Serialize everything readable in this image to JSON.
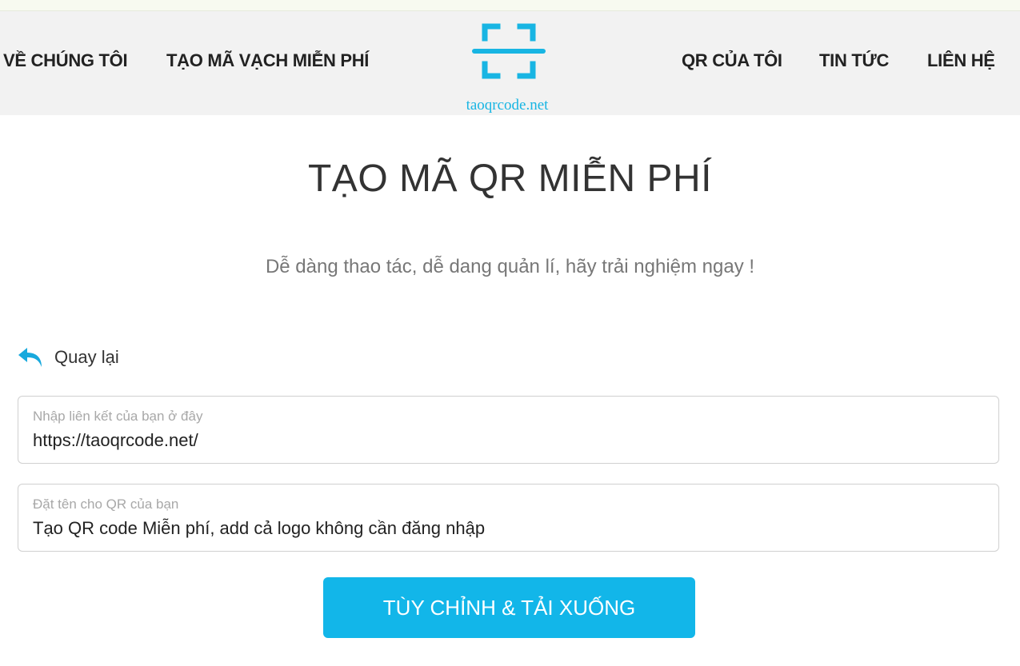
{
  "nav": {
    "left": [
      "VỀ CHÚNG TÔI",
      "TẠO MÃ VẠCH MIỄN PHÍ"
    ],
    "right": [
      "QR CỦA TÔI",
      "TIN TỨC",
      "LIÊN HỆ"
    ]
  },
  "logo": {
    "text": "taoqrcode.net",
    "icon": "scan-frame-icon",
    "color": "#18b5e3"
  },
  "hero": {
    "title": "TẠO MÃ QR MIỄN PHÍ",
    "subtitle": "Dễ dàng thao tác, dễ dang quản lí, hãy trải nghiệm ngay !"
  },
  "back": {
    "label": "Quay lại",
    "icon": "back-arrow-icon"
  },
  "form": {
    "link_label": "Nhập liên kết của bạn ở đây",
    "link_value": "https://taoqrcode.net/",
    "name_label": "Đặt tên cho QR của bạn",
    "name_value": "Tạo QR code Miễn phí, add cả logo không cần đăng nhập"
  },
  "cta": {
    "label": "TÙY CHỈNH & TẢI XUỐNG",
    "color": "#12b6e9"
  }
}
